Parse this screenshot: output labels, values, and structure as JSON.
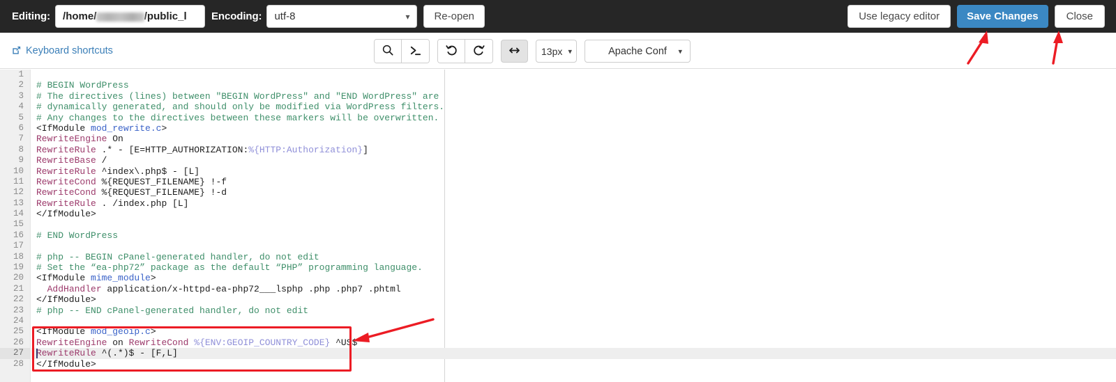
{
  "header": {
    "editing_label": "Editing:",
    "file_path_prefix": "/home/",
    "file_path_redacted": "mwa-admin",
    "file_path_suffix": "/public_l",
    "encoding_label": "Encoding:",
    "encoding_value": "utf-8",
    "encoding_options": [
      "utf-8"
    ],
    "reopen_label": "Re-open",
    "legacy_editor_label": "Use legacy editor",
    "save_changes_label": "Save Changes",
    "close_label": "Close",
    "background_color": "#262626",
    "save_button_color": "#3b88c3"
  },
  "toolbar": {
    "keyboard_shortcuts_label": "Keyboard shortcuts",
    "keyboard_shortcuts_color": "#3b7fb8",
    "search_icon": "search-icon",
    "console_icon": "terminal-prompt-icon",
    "undo_icon": "undo-arrow-icon",
    "redo_icon": "redo-arrow-icon",
    "wrap_icon": "horizontal-arrows-icon",
    "wrap_active": true,
    "font_size_value": "13px",
    "font_size_options": [
      "13px"
    ],
    "mode_value": "Apache Conf",
    "mode_options": [
      "Apache Conf"
    ]
  },
  "editor": {
    "active_line": 27,
    "caret_line": 27,
    "total_lines": 28,
    "lines": [
      {
        "n": 1,
        "tokens": []
      },
      {
        "n": 2,
        "tokens": [
          {
            "t": "comment",
            "x": "# BEGIN WordPress"
          }
        ]
      },
      {
        "n": 3,
        "tokens": [
          {
            "t": "comment",
            "x": "# The directives (lines) between \"BEGIN WordPress\" and \"END WordPress\" are"
          }
        ]
      },
      {
        "n": 4,
        "tokens": [
          {
            "t": "comment",
            "x": "# dynamically generated, and should only be modified via WordPress filters."
          }
        ]
      },
      {
        "n": 5,
        "tokens": [
          {
            "t": "comment",
            "x": "# Any changes to the directives between these markers will be overwritten."
          }
        ]
      },
      {
        "n": 6,
        "tokens": [
          {
            "t": "tag",
            "x": "<IfModule "
          },
          {
            "t": "modname",
            "x": "mod_rewrite.c"
          },
          {
            "t": "tag",
            "x": ">"
          }
        ]
      },
      {
        "n": 7,
        "tokens": [
          {
            "t": "directive",
            "x": "RewriteEngine"
          },
          {
            "t": "plain",
            "x": " On"
          }
        ]
      },
      {
        "n": 8,
        "tokens": [
          {
            "t": "directive",
            "x": "RewriteRule"
          },
          {
            "t": "plain",
            "x": " .* - [E=HTTP_AUTHORIZATION:"
          },
          {
            "t": "var",
            "x": "%{HTTP:Authorization}"
          },
          {
            "t": "plain",
            "x": "]"
          }
        ]
      },
      {
        "n": 9,
        "tokens": [
          {
            "t": "directive",
            "x": "RewriteBase"
          },
          {
            "t": "plain",
            "x": " /"
          }
        ]
      },
      {
        "n": 10,
        "tokens": [
          {
            "t": "directive",
            "x": "RewriteRule"
          },
          {
            "t": "plain",
            "x": " ^index\\.php$ - [L]"
          }
        ]
      },
      {
        "n": 11,
        "tokens": [
          {
            "t": "directive",
            "x": "RewriteCond"
          },
          {
            "t": "plain",
            "x": " %{REQUEST_FILENAME} !-f"
          }
        ]
      },
      {
        "n": 12,
        "tokens": [
          {
            "t": "directive",
            "x": "RewriteCond"
          },
          {
            "t": "plain",
            "x": " %{REQUEST_FILENAME} !-d"
          }
        ]
      },
      {
        "n": 13,
        "tokens": [
          {
            "t": "directive",
            "x": "RewriteRule"
          },
          {
            "t": "plain",
            "x": " . /index.php [L]"
          }
        ]
      },
      {
        "n": 14,
        "tokens": [
          {
            "t": "tag",
            "x": "</IfModule>"
          }
        ]
      },
      {
        "n": 15,
        "tokens": []
      },
      {
        "n": 16,
        "tokens": [
          {
            "t": "comment",
            "x": "# END WordPress"
          }
        ]
      },
      {
        "n": 17,
        "tokens": []
      },
      {
        "n": 18,
        "tokens": [
          {
            "t": "comment",
            "x": "# php -- BEGIN cPanel-generated handler, do not edit"
          }
        ]
      },
      {
        "n": 19,
        "tokens": [
          {
            "t": "comment",
            "x": "# Set the “ea-php72” package as the default “PHP” programming language."
          }
        ]
      },
      {
        "n": 20,
        "tokens": [
          {
            "t": "tag",
            "x": "<IfModule "
          },
          {
            "t": "modname",
            "x": "mime_module"
          },
          {
            "t": "tag",
            "x": ">"
          }
        ]
      },
      {
        "n": 21,
        "tokens": [
          {
            "t": "plain",
            "x": "  "
          },
          {
            "t": "directive",
            "x": "AddHandler"
          },
          {
            "t": "plain",
            "x": " application/x-httpd-ea-php72___lsphp .php .php7 .phtml"
          }
        ]
      },
      {
        "n": 22,
        "tokens": [
          {
            "t": "tag",
            "x": "</IfModule>"
          }
        ]
      },
      {
        "n": 23,
        "tokens": [
          {
            "t": "comment",
            "x": "# php -- END cPanel-generated handler, do not edit"
          }
        ]
      },
      {
        "n": 24,
        "tokens": []
      },
      {
        "n": 25,
        "tokens": [
          {
            "t": "tag",
            "x": "<IfModule "
          },
          {
            "t": "modname",
            "x": "mod_geoip.c"
          },
          {
            "t": "tag",
            "x": ">"
          }
        ]
      },
      {
        "n": 26,
        "tokens": [
          {
            "t": "directive",
            "x": "RewriteEngine"
          },
          {
            "t": "plain",
            "x": " on "
          },
          {
            "t": "directive",
            "x": "RewriteCond"
          },
          {
            "t": "plain",
            "x": " "
          },
          {
            "t": "var",
            "x": "%{ENV:GEOIP_COUNTRY_CODE}"
          },
          {
            "t": "plain",
            "x": " ^US$"
          }
        ]
      },
      {
        "n": 27,
        "tokens": [
          {
            "t": "directive",
            "x": "RewriteRule"
          },
          {
            "t": "plain",
            "x": " ^(.*)$ - [F,L]"
          }
        ]
      },
      {
        "n": 28,
        "tokens": [
          {
            "t": "tag",
            "x": "</IfModule>"
          }
        ]
      }
    ]
  },
  "annotations": {
    "highlight_color": "#ec1c24",
    "box_target_lines": "25-28",
    "arrows": [
      "arrow-pointing-to-geoip-block",
      "arrow-pointing-to-save-changes",
      "arrow-pointing-to-close"
    ]
  }
}
